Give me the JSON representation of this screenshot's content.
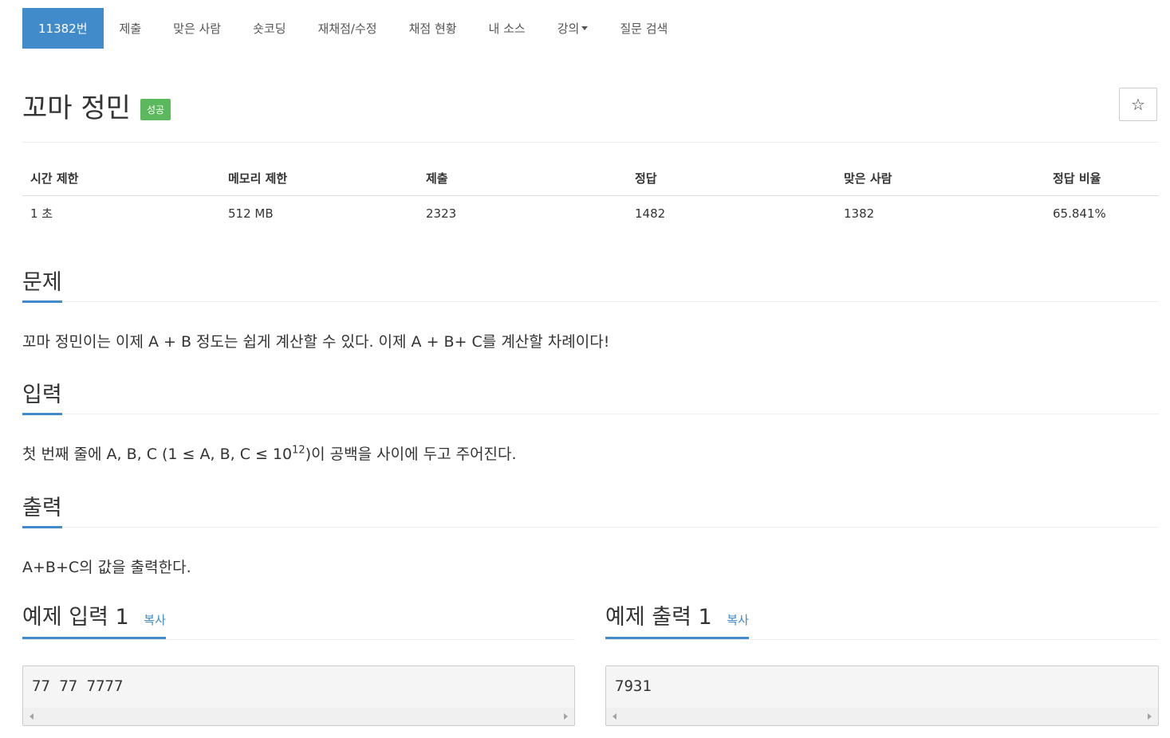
{
  "nav": {
    "items": [
      {
        "label": "11382번"
      },
      {
        "label": "제출"
      },
      {
        "label": "맞은 사람"
      },
      {
        "label": "숏코딩"
      },
      {
        "label": "재채점/수정"
      },
      {
        "label": "채점 현황"
      },
      {
        "label": "내 소스"
      },
      {
        "label": "강의"
      },
      {
        "label": "질문 검색"
      }
    ]
  },
  "problem": {
    "title": "꼬마 정민",
    "badge": "성공",
    "badge_color": "#5cb85c",
    "star": "☆"
  },
  "info_table": {
    "headers": [
      "시간 제한",
      "메모리 제한",
      "제출",
      "정답",
      "맞은 사람",
      "정답 비율"
    ],
    "row": [
      "1 초",
      "512 MB",
      "2323",
      "1482",
      "1382",
      "65.841%"
    ]
  },
  "sections": {
    "problem_title": "문제",
    "problem_text": "꼬마 정민이는 이제 A + B 정도는 쉽게 계산할 수 있다. 이제 A + B+ C를 계산할 차례이다!",
    "input_title": "입력",
    "input_text_pre": "첫 번째 줄에 A, B, C (1 ≤ A, B, C ≤ 10",
    "input_text_sup": "12",
    "input_text_post": ")이 공백을 사이에 두고 주어진다.",
    "output_title": "출력",
    "output_text": "A+B+C의 값을 출력한다."
  },
  "samples": {
    "input_title": "예제 입력 1",
    "input_copy": "복사",
    "input_value": "77 77 7777",
    "output_title": "예제 출력 1",
    "output_copy": "복사",
    "output_value": "7931"
  },
  "colors": {
    "accent": "#428bca",
    "success": "#5cb85c"
  }
}
